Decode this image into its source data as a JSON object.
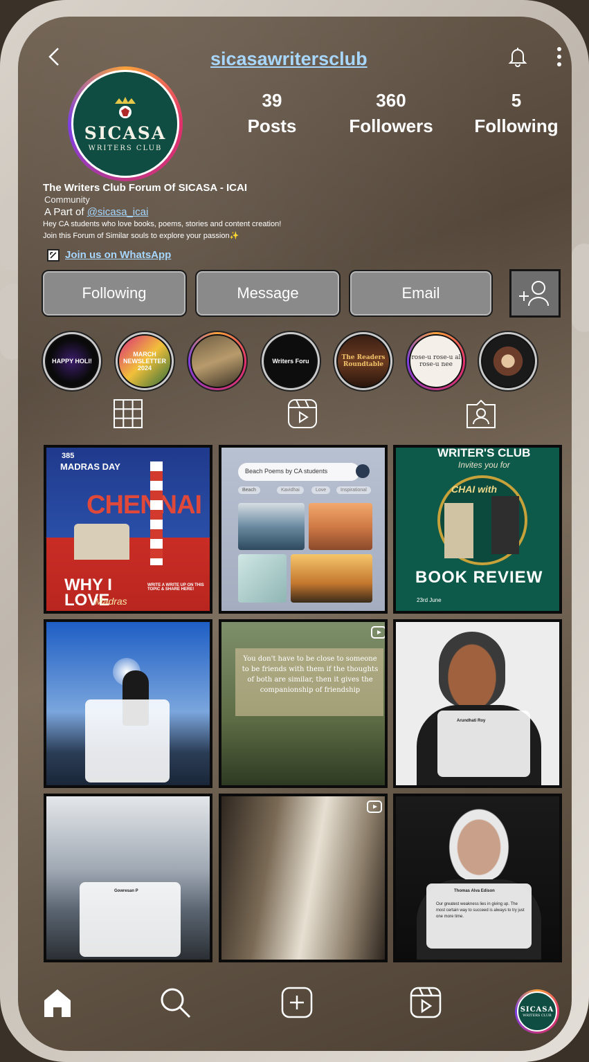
{
  "header": {
    "username": "sicasawritersclub"
  },
  "avatar": {
    "logo_main": "SICASA",
    "logo_sub": "WRITERS CLUB"
  },
  "stats": [
    {
      "value": "39",
      "label": "Posts"
    },
    {
      "value": "360",
      "label": "Followers"
    },
    {
      "value": "5",
      "label": "Following"
    }
  ],
  "bio": {
    "name": "The Writers Club Forum Of SICASA - ICAI",
    "category": "Community",
    "part_prefix": "A Part of ",
    "part_handle": "@sicasa_icai",
    "line1": "Hey CA students who love books, poems, stories and content creation!",
    "line2": "Join this Forum of Similar souls to explore your passion✨",
    "link": "Join us on WhatsApp"
  },
  "buttons": {
    "following": "Following",
    "message": "Message",
    "email": "Email"
  },
  "highlights": [
    {
      "text": "HAPPY HOLI!"
    },
    {
      "text": "MARCH NEWSLETTER 2024"
    },
    {
      "text": ""
    },
    {
      "text": "Writers Foru"
    },
    {
      "text": "The Readers Roundtable"
    },
    {
      "text": "rose-u rose-u al rose-u nee"
    },
    {
      "text": ""
    }
  ],
  "tabs": [
    "grid-icon",
    "reels-icon",
    "tagged-icon"
  ],
  "posts": {
    "p1": {
      "t1": "385",
      "t2": "MADRAS DAY",
      "t3": "CHENNAI",
      "t4": "WHY I LOVE",
      "t5": "Madras",
      "t6": "WRITE A WRITE UP ON THIS TOPIC & SHARE HERE!"
    },
    "p2": {
      "search": "Beach Poems by CA students",
      "chips": [
        "Beach",
        "Kavidhai",
        "Love",
        "Inspirational"
      ]
    },
    "p3": {
      "t1": "WRITER'S CLUB",
      "t2": "Invites you for",
      "t3": "CHAI with",
      "t4": "BOOK REVIEW",
      "t5": "23rd June"
    },
    "p5": {
      "quote": "You don't have to be close to someone to be friends with them if the thoughts of both are similar, then it gives the companionship of friendship"
    },
    "p6": {
      "name": "Arundhati Roy"
    },
    "p7": {
      "name": "Gowresan P"
    },
    "p9": {
      "name": "Thomas Alva Edison",
      "quote": "Our greatest weakness lies in giving up. The most certain way to succeed is always to try just one more time."
    }
  },
  "nav": [
    "home-icon",
    "search-icon",
    "create-icon",
    "reels-icon",
    "profile-avatar"
  ],
  "colors": {
    "link": "#a7d6ff",
    "accent_ring": "#e1306c",
    "logo_green": "#0f4d42"
  }
}
